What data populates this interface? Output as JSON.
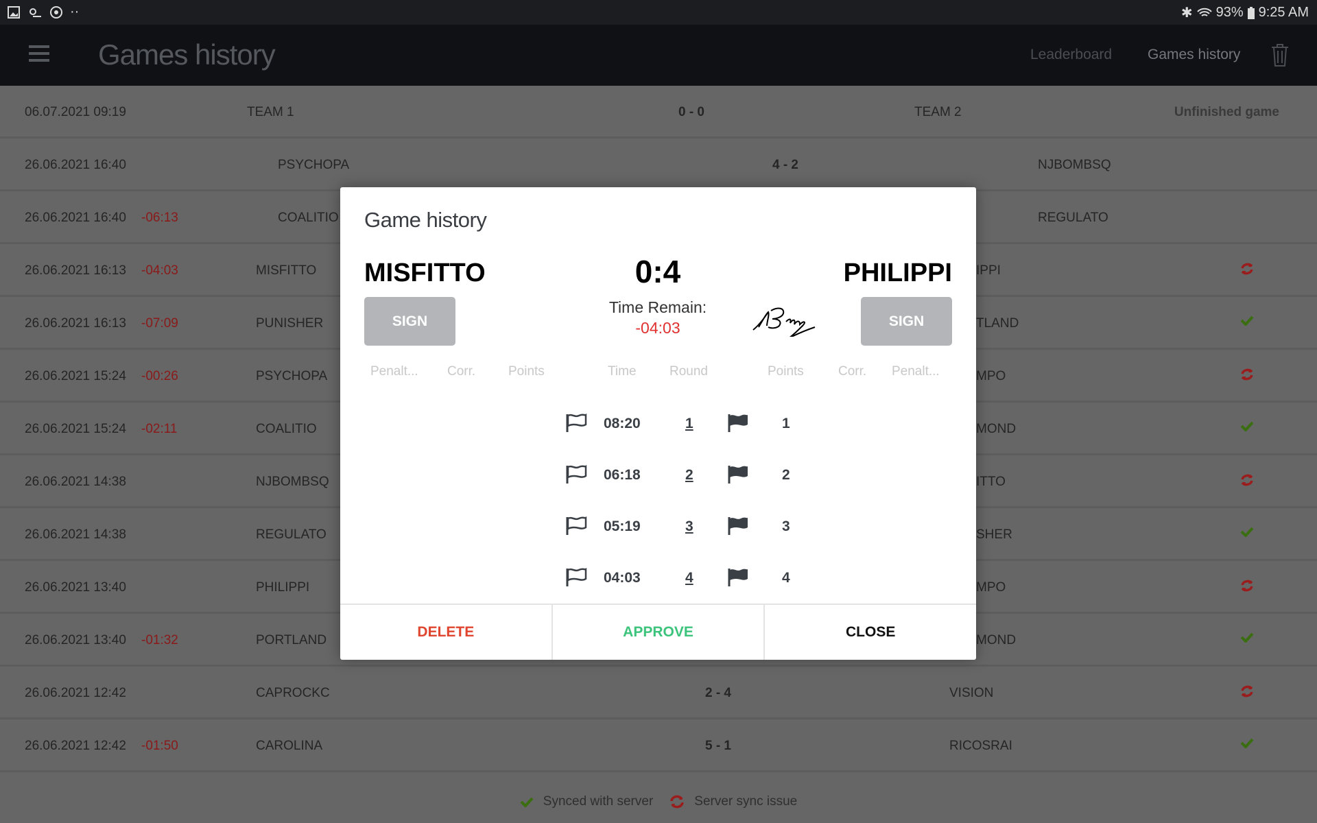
{
  "status_bar": {
    "battery": "93%",
    "time": "9:25 AM"
  },
  "appbar": {
    "title": "Games history",
    "nav": [
      "Leaderboard",
      "Games history"
    ]
  },
  "colors": {
    "synced": "#3a6e10",
    "sync_issue": "#9a1c1c",
    "remain": "#e03030",
    "delete": "#e0452f",
    "approve": "#3cc47c"
  },
  "rows": [
    {
      "date": "06.07.2021 09:19",
      "remain": "",
      "team1": "TEAM 1",
      "score": "0 - 0",
      "team2": "TEAM 2",
      "status": "Unfinished game"
    },
    {
      "date": "26.06.2021 16:40",
      "remain": "",
      "team1": "PSYCHOPA",
      "score": "4 - 2",
      "team2": "NJBOMBSQ",
      "status": ""
    },
    {
      "date": "26.06.2021 16:40",
      "remain": "-06:13",
      "team1": "COALITIO",
      "score": "",
      "team2": "REGULATO",
      "status": ""
    },
    {
      "date": "26.06.2021 16:13",
      "remain": "-04:03",
      "team1": "MISFITTO",
      "score": "",
      "team2": "IPPI",
      "status": "sync-issue"
    },
    {
      "date": "26.06.2021 16:13",
      "remain": "-07:09",
      "team1": "PUNISHER",
      "score": "",
      "team2": "TLAND",
      "status": "synced"
    },
    {
      "date": "26.06.2021 15:24",
      "remain": "-00:26",
      "team1": "PSYCHOPA",
      "score": "",
      "team2": "MPO",
      "status": "sync-issue"
    },
    {
      "date": "26.06.2021 15:24",
      "remain": "-02:11",
      "team1": "COALITIO",
      "score": "",
      "team2": "MOND",
      "status": "synced"
    },
    {
      "date": "26.06.2021 14:38",
      "remain": "",
      "team1": "NJBOMBSQ",
      "score": "",
      "team2": "ITTO",
      "status": "sync-issue"
    },
    {
      "date": "26.06.2021 14:38",
      "remain": "",
      "team1": "REGULATO",
      "score": "",
      "team2": "SHER",
      "status": "synced"
    },
    {
      "date": "26.06.2021 13:40",
      "remain": "",
      "team1": "PHILIPPI",
      "score": "",
      "team2": "MPO",
      "status": "sync-issue"
    },
    {
      "date": "26.06.2021 13:40",
      "remain": "-01:32",
      "team1": "PORTLAND",
      "score": "",
      "team2": "MOND",
      "status": "synced"
    },
    {
      "date": "26.06.2021 12:42",
      "remain": "",
      "team1": "CAPROCKC",
      "score": "2 - 4",
      "team2": "VISION",
      "status": "sync-issue"
    },
    {
      "date": "26.06.2021 12:42",
      "remain": "-01:50",
      "team1": "CAROLINA",
      "score": "5 - 1",
      "team2": "RICOSRAI",
      "status": "synced"
    }
  ],
  "footer": {
    "synced": "Synced with server",
    "issue": "Server sync issue"
  },
  "modal": {
    "title": "Game history",
    "team1": "MISFITTO",
    "team2": "PHILIPPI",
    "score": "0:4",
    "sign_label": "SIGN",
    "time_remain_label": "Time Remain:",
    "time_remain": "-04:03",
    "headers": [
      "Penalt...",
      "Corr.",
      "Points",
      "Time",
      "Round",
      "Points",
      "Corr.",
      "Penalt..."
    ],
    "events": [
      {
        "time": "08:20",
        "round": "1",
        "points": "1"
      },
      {
        "time": "06:18",
        "round": "2",
        "points": "2"
      },
      {
        "time": "05:19",
        "round": "3",
        "points": "3"
      },
      {
        "time": "04:03",
        "round": "4",
        "points": "4"
      }
    ],
    "buttons": {
      "delete": "DELETE",
      "approve": "APPROVE",
      "close": "CLOSE"
    }
  }
}
